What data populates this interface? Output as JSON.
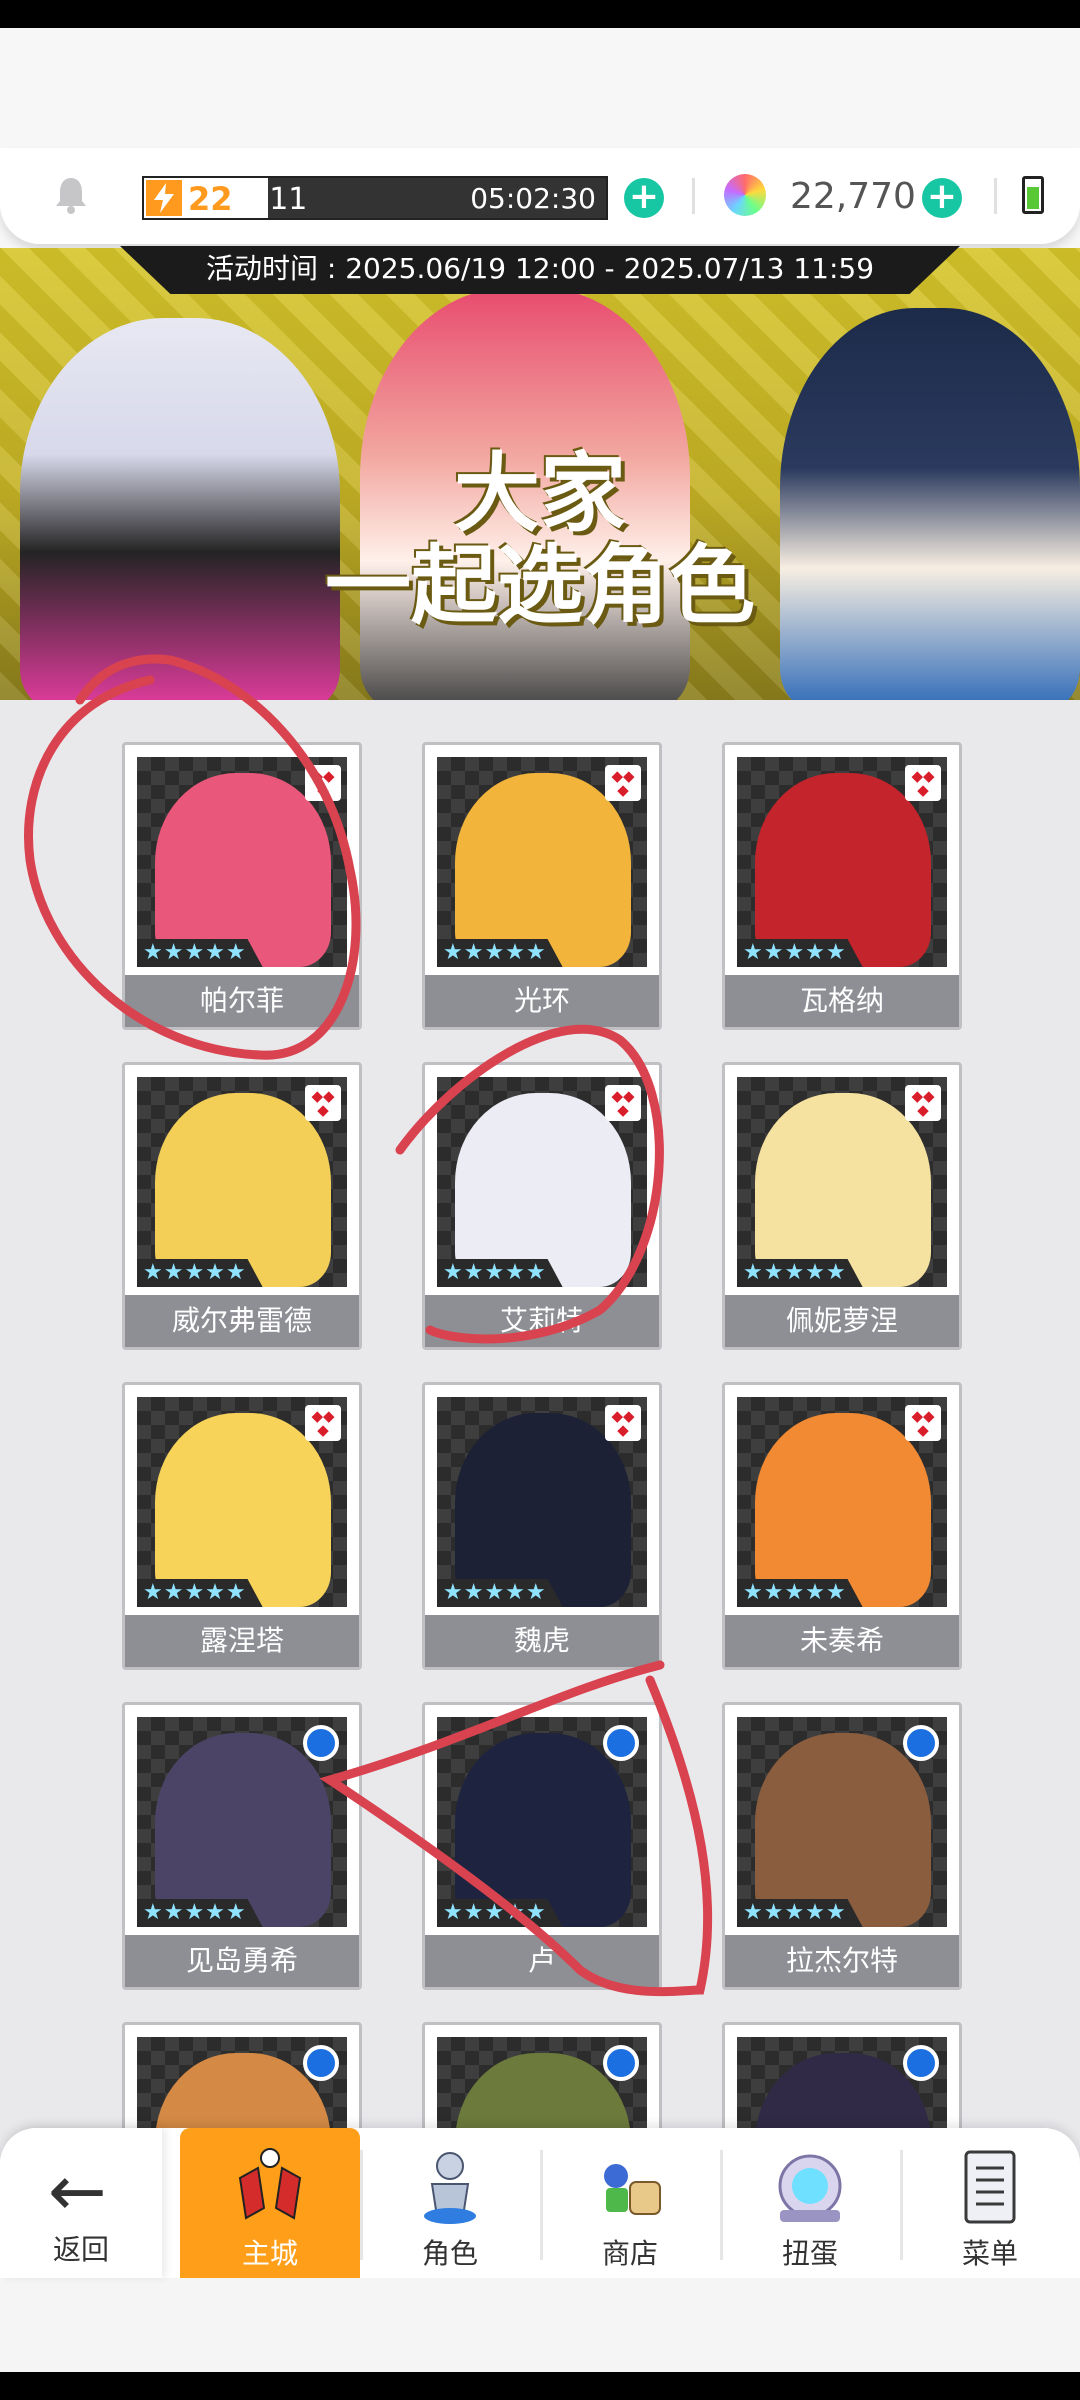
{
  "resources": {
    "stamina_current": "22",
    "stamina_max": "/111",
    "stamina_timer": "05:02:30",
    "stamina_fraction": 0.198,
    "gem_count": "22,770",
    "plus_symbol": "+"
  },
  "banner": {
    "event_period": "活动时间 : 2025.06/19 12:00 - 2025.07/13 11:59",
    "title_line1": "大家",
    "title_line2": "一起选角色"
  },
  "characters": [
    {
      "name": "帕尔菲",
      "stars": "★★★★★",
      "type": "diamond",
      "face_color": "#e9577a"
    },
    {
      "name": "光环",
      "stars": "★★★★★",
      "type": "diamond",
      "face_color": "#f2b43b"
    },
    {
      "name": "瓦格纳",
      "stars": "★★★★★",
      "type": "diamond",
      "face_color": "#c4242b"
    },
    {
      "name": "威尔弗雷德",
      "stars": "★★★★★",
      "type": "diamond",
      "face_color": "#f3cf58"
    },
    {
      "name": "艾莉特",
      "stars": "★★★★★",
      "type": "diamond",
      "face_color": "#ececf4"
    },
    {
      "name": "佩妮萝涅",
      "stars": "★★★★★",
      "type": "diamond",
      "face_color": "#f6e2a0"
    },
    {
      "name": "露涅塔",
      "stars": "★★★★★",
      "type": "diamond",
      "face_color": "#f8d35a"
    },
    {
      "name": "魏虎",
      "stars": "★★★★★",
      "type": "diamond",
      "face_color": "#1d2136"
    },
    {
      "name": "未奏希",
      "stars": "★★★★★",
      "type": "diamond",
      "face_color": "#f28a33"
    },
    {
      "name": "见岛勇希",
      "stars": "★★★★★",
      "type": "circle",
      "face_color": "#4b4466"
    },
    {
      "name": "卢",
      "stars": "★★★★★",
      "type": "circle",
      "face_color": "#1e2440"
    },
    {
      "name": "拉杰尔特",
      "stars": "★★★★★",
      "type": "circle",
      "face_color": "#8b5d3f"
    },
    {
      "name": "",
      "stars": "",
      "type": "circle",
      "face_color": "#d48a45"
    },
    {
      "name": "",
      "stars": "",
      "type": "circle",
      "face_color": "#6c7a3c"
    },
    {
      "name": "",
      "stars": "",
      "type": "circle",
      "face_color": "#312a46"
    }
  ],
  "nav": {
    "back": "返回",
    "items": [
      {
        "label": "主城",
        "icon": "castle-icon",
        "active": true
      },
      {
        "label": "角色",
        "icon": "character-icon",
        "active": false
      },
      {
        "label": "商店",
        "icon": "shop-icon",
        "active": false
      },
      {
        "label": "扭蛋",
        "icon": "gacha-icon",
        "active": false
      },
      {
        "label": "菜单",
        "icon": "menu-icon",
        "active": false
      }
    ]
  },
  "colors": {
    "accent_orange": "#ff9f19",
    "plus_green": "#17c6a3",
    "annotation_red": "#d9434f"
  }
}
